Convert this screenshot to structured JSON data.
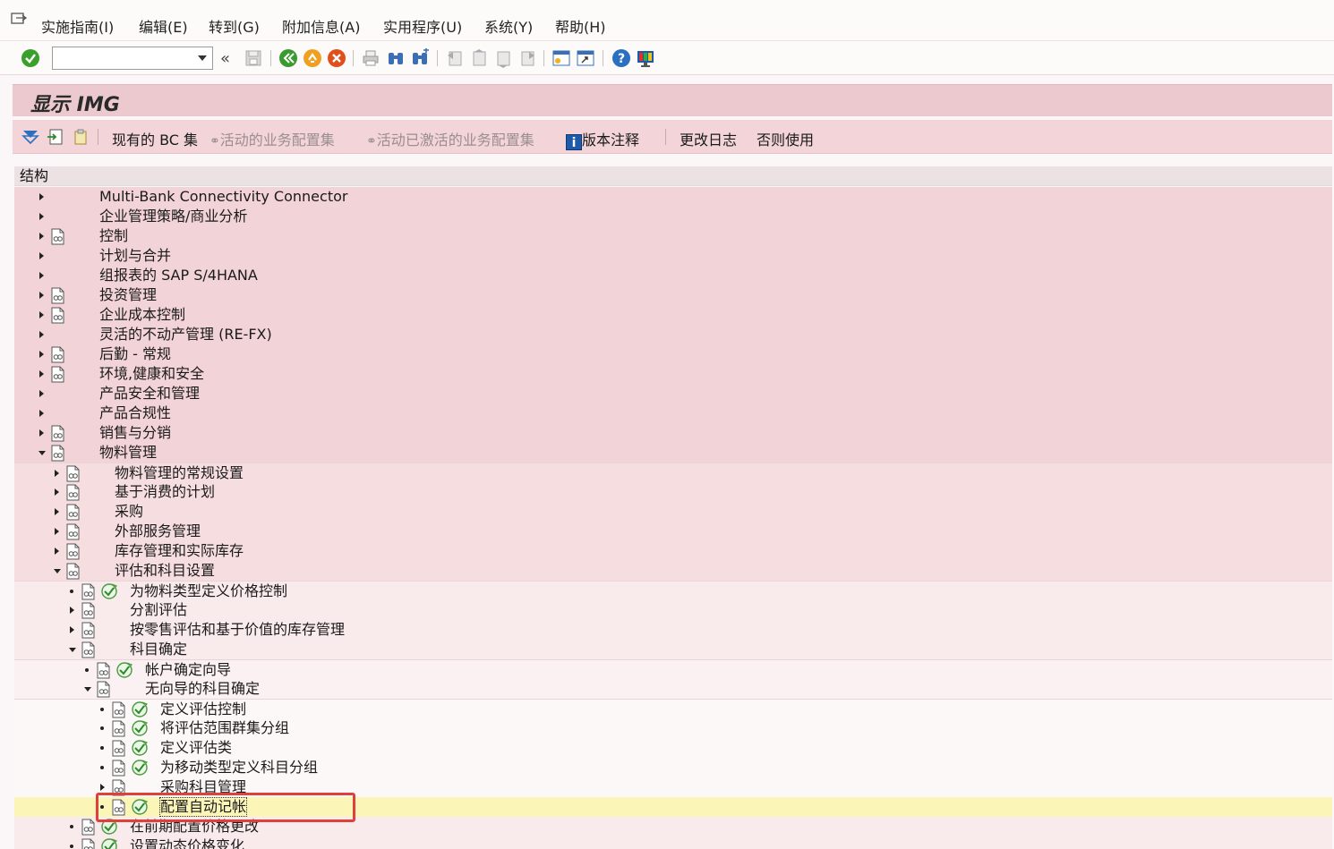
{
  "menu": {
    "items": [
      "实施指南(I)",
      "编辑(E)",
      "转到(G)",
      "附加信息(A)",
      "实用程序(U)",
      "系统(Y)",
      "帮助(H)"
    ]
  },
  "toolbar": {
    "command_value": "",
    "icons": [
      "check-icon",
      "back-icon",
      "exit-icon",
      "cancel-icon",
      "print-icon",
      "find-icon",
      "find-next-icon",
      "first-page-icon",
      "prev-page-icon",
      "next-page-icon",
      "last-page-icon",
      "create-session-icon",
      "shortcut-icon",
      "help-icon",
      "customize-layout-icon"
    ]
  },
  "title": "显示 IMG",
  "app_toolbar": {
    "current_bc": "现有的 BC 集",
    "active_bc": "活动的业务配置集",
    "activated_bc": "活动已激活的业务配置集",
    "release_notes": "版本注释",
    "change_log": "更改日志",
    "otherwise_use": "否则使用"
  },
  "tree": {
    "header": "结构",
    "rows": [
      {
        "label": "Multi-Bank Connectivity Connector",
        "level": 0,
        "state": "collapsed",
        "doc": false,
        "exec": false
      },
      {
        "label": "企业管理策略/商业分析",
        "level": 0,
        "state": "collapsed",
        "doc": false,
        "exec": false
      },
      {
        "label": "控制",
        "level": 0,
        "state": "collapsed",
        "doc": true,
        "exec": false
      },
      {
        "label": "计划与合并",
        "level": 0,
        "state": "collapsed",
        "doc": false,
        "exec": false
      },
      {
        "label": "组报表的 SAP S/4HANA",
        "level": 0,
        "state": "collapsed",
        "doc": false,
        "exec": false
      },
      {
        "label": "投资管理",
        "level": 0,
        "state": "collapsed",
        "doc": true,
        "exec": false
      },
      {
        "label": "企业成本控制",
        "level": 0,
        "state": "collapsed",
        "doc": true,
        "exec": false
      },
      {
        "label": "灵活的不动产管理 (RE-FX)",
        "level": 0,
        "state": "collapsed",
        "doc": false,
        "exec": false
      },
      {
        "label": "后勤 - 常规",
        "level": 0,
        "state": "collapsed",
        "doc": true,
        "exec": false
      },
      {
        "label": "环境,健康和安全",
        "level": 0,
        "state": "collapsed",
        "doc": true,
        "exec": false
      },
      {
        "label": "产品安全和管理",
        "level": 0,
        "state": "collapsed",
        "doc": false,
        "exec": false
      },
      {
        "label": "产品合规性",
        "level": 0,
        "state": "collapsed",
        "doc": false,
        "exec": false
      },
      {
        "label": "销售与分销",
        "level": 0,
        "state": "collapsed",
        "doc": true,
        "exec": false
      },
      {
        "label": "物料管理",
        "level": 0,
        "state": "expanded",
        "doc": true,
        "exec": false
      },
      {
        "label": "物料管理的常规设置",
        "level": 1,
        "state": "collapsed",
        "doc": true,
        "exec": false
      },
      {
        "label": "基于消费的计划",
        "level": 1,
        "state": "collapsed",
        "doc": true,
        "exec": false
      },
      {
        "label": "采购",
        "level": 1,
        "state": "collapsed",
        "doc": true,
        "exec": false
      },
      {
        "label": "外部服务管理",
        "level": 1,
        "state": "collapsed",
        "doc": true,
        "exec": false
      },
      {
        "label": "库存管理和实际库存",
        "level": 1,
        "state": "collapsed",
        "doc": true,
        "exec": false
      },
      {
        "label": "评估和科目设置",
        "level": 1,
        "state": "expanded",
        "doc": true,
        "exec": false
      },
      {
        "label": "为物料类型定义价格控制",
        "level": 2,
        "state": "leaf",
        "doc": true,
        "exec": true
      },
      {
        "label": "分割评估",
        "level": 2,
        "state": "collapsed",
        "doc": true,
        "exec": false
      },
      {
        "label": "按零售评估和基于价值的库存管理",
        "level": 2,
        "state": "collapsed",
        "doc": true,
        "exec": false
      },
      {
        "label": "科目确定",
        "level": 2,
        "state": "expanded",
        "doc": true,
        "exec": false
      },
      {
        "label": "帐户确定向导",
        "level": 3,
        "state": "leaf",
        "doc": true,
        "exec": true
      },
      {
        "label": "无向导的科目确定",
        "level": 3,
        "state": "expanded",
        "doc": true,
        "exec": false
      },
      {
        "label": "定义评估控制",
        "level": 4,
        "state": "leaf",
        "doc": true,
        "exec": true
      },
      {
        "label": "将评估范围群集分组",
        "level": 4,
        "state": "leaf",
        "doc": true,
        "exec": true
      },
      {
        "label": "定义评估类",
        "level": 4,
        "state": "leaf",
        "doc": true,
        "exec": true
      },
      {
        "label": "为移动类型定义科目分组",
        "level": 4,
        "state": "leaf",
        "doc": true,
        "exec": true
      },
      {
        "label": "采购科目管理",
        "level": 4,
        "state": "collapsed",
        "doc": true,
        "exec": false
      },
      {
        "label": "配置自动记帐",
        "level": 4,
        "state": "leaf",
        "doc": true,
        "exec": true,
        "selected": true
      },
      {
        "label": "在前期配置价格更改",
        "level": 2,
        "state": "leaf",
        "doc": true,
        "exec": true
      },
      {
        "label": "设置动态价格变化",
        "level": 2,
        "state": "leaf",
        "doc": true,
        "exec": true
      }
    ]
  },
  "colors": {
    "level0_bg": "#f2d3d7",
    "level1_bg": "#f5dde0",
    "level2_bg": "#f9eaec",
    "level3_bg": "#fbf1f2",
    "level4_bg": "#fdf8f8",
    "selected_bg": "#fbf6b8",
    "highlight_border": "#e0403c"
  }
}
